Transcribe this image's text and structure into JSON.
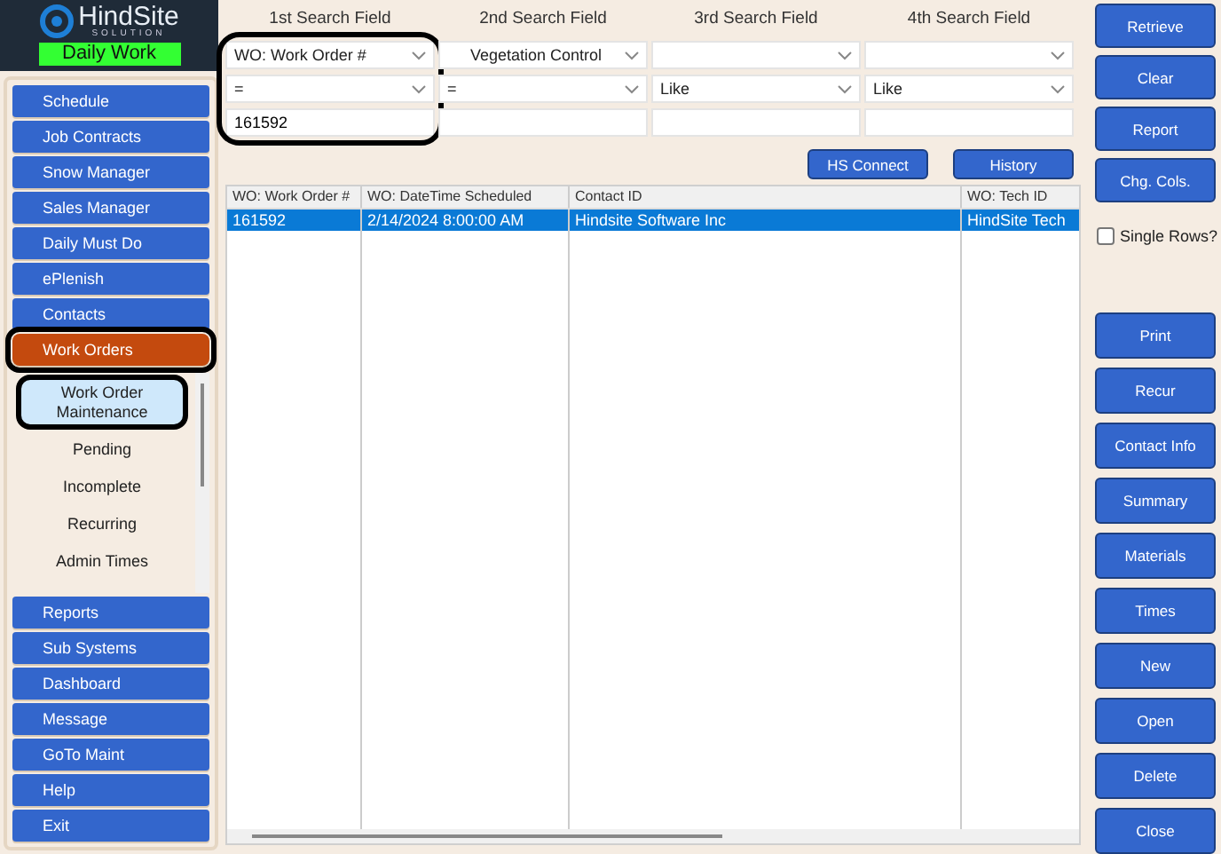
{
  "logo": {
    "name": "HindSite",
    "tagline": "SOLUTION",
    "module": "Daily Work"
  },
  "sidebar": {
    "top_items": [
      {
        "label": "Schedule",
        "selected": false,
        "highlighted": false
      },
      {
        "label": "Job Contracts",
        "selected": false,
        "highlighted": false
      },
      {
        "label": "Snow Manager",
        "selected": false,
        "highlighted": false
      },
      {
        "label": "Sales Manager",
        "selected": false,
        "highlighted": false
      },
      {
        "label": "Daily Must Do",
        "selected": false,
        "highlighted": false
      },
      {
        "label": "ePlenish",
        "selected": false,
        "highlighted": false
      },
      {
        "label": "Contacts",
        "selected": false,
        "highlighted": false
      },
      {
        "label": "Work Orders",
        "selected": true,
        "highlighted": true
      }
    ],
    "submenu": [
      {
        "label": "Work Order Maintenance",
        "selected": true,
        "highlighted": true
      },
      {
        "label": "Pending",
        "selected": false,
        "highlighted": false
      },
      {
        "label": "Incomplete",
        "selected": false,
        "highlighted": false
      },
      {
        "label": "Recurring",
        "selected": false,
        "highlighted": false
      },
      {
        "label": "Admin Times",
        "selected": false,
        "highlighted": false
      }
    ],
    "bottom_items": [
      {
        "label": "Reports",
        "selected": false,
        "highlighted": false
      },
      {
        "label": "Sub Systems",
        "selected": false,
        "highlighted": false
      },
      {
        "label": "Dashboard",
        "selected": false,
        "highlighted": false
      },
      {
        "label": "Message",
        "selected": false,
        "highlighted": false
      },
      {
        "label": "GoTo Maint",
        "selected": false,
        "highlighted": false
      },
      {
        "label": "Help",
        "selected": false,
        "highlighted": false
      },
      {
        "label": "Exit",
        "selected": false,
        "highlighted": false
      }
    ]
  },
  "search_fields": [
    {
      "label": "1st Search Field",
      "field": "WO: Work Order #",
      "operator": "=",
      "value": "161592",
      "highlighted": true
    },
    {
      "label": "2nd Search Field",
      "field": "Vegetation Control",
      "operator": "=",
      "highlighted": false
    },
    {
      "label": "3rd Search Field",
      "operator": "Like",
      "highlighted": false
    },
    {
      "label": "4th Search Field",
      "operator": "Like",
      "highlighted": false
    }
  ],
  "search_buttons": [
    "HS Connect",
    "History"
  ],
  "table": {
    "columns": [
      "WO: Work Order #",
      "WO: DateTime Scheduled",
      "Contact ID",
      "WO: Tech ID"
    ],
    "rows": [
      {
        "cells": [
          "161592",
          "2/14/2024 8:00:00 AM",
          "Hindsite Software Inc",
          "HindSite Tech"
        ],
        "selected": true
      }
    ]
  },
  "top_buttons": [
    "Retrieve",
    "Clear",
    "Report",
    "Chg. Cols."
  ],
  "single_rows": {
    "label": "Single Rows?",
    "checked": false
  },
  "action_buttons": [
    "Print",
    "Recur",
    "Contact Info",
    "Summary",
    "Materials",
    "Times",
    "New",
    "Open",
    "Delete",
    "Close"
  ]
}
